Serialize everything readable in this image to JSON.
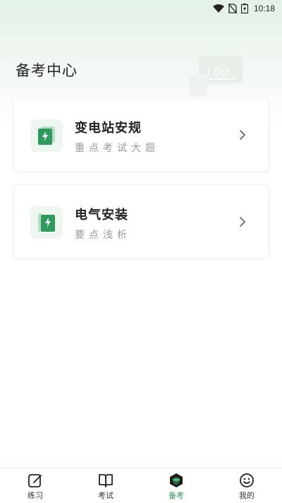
{
  "status_bar": {
    "time": "10:18"
  },
  "page": {
    "title": "备考中心"
  },
  "decoration": {
    "badge_text": "100"
  },
  "cards": [
    {
      "title": "变电站安规",
      "subtitle": "重点考试大题"
    },
    {
      "title": "电气安装",
      "subtitle": "要点浅析"
    }
  ],
  "tabbar": {
    "items": [
      {
        "label": "练习",
        "icon": "practice-edit-icon"
      },
      {
        "label": "考试",
        "icon": "exam-book-icon"
      },
      {
        "label": "备考",
        "icon": "prep-hexagon-icon",
        "active": true
      },
      {
        "label": "我的",
        "icon": "profile-smile-icon"
      }
    ]
  },
  "colors": {
    "accent": "#2f9a5d",
    "icon_bg": "#eef6f0",
    "header_gradient": "#e3f1e6"
  }
}
